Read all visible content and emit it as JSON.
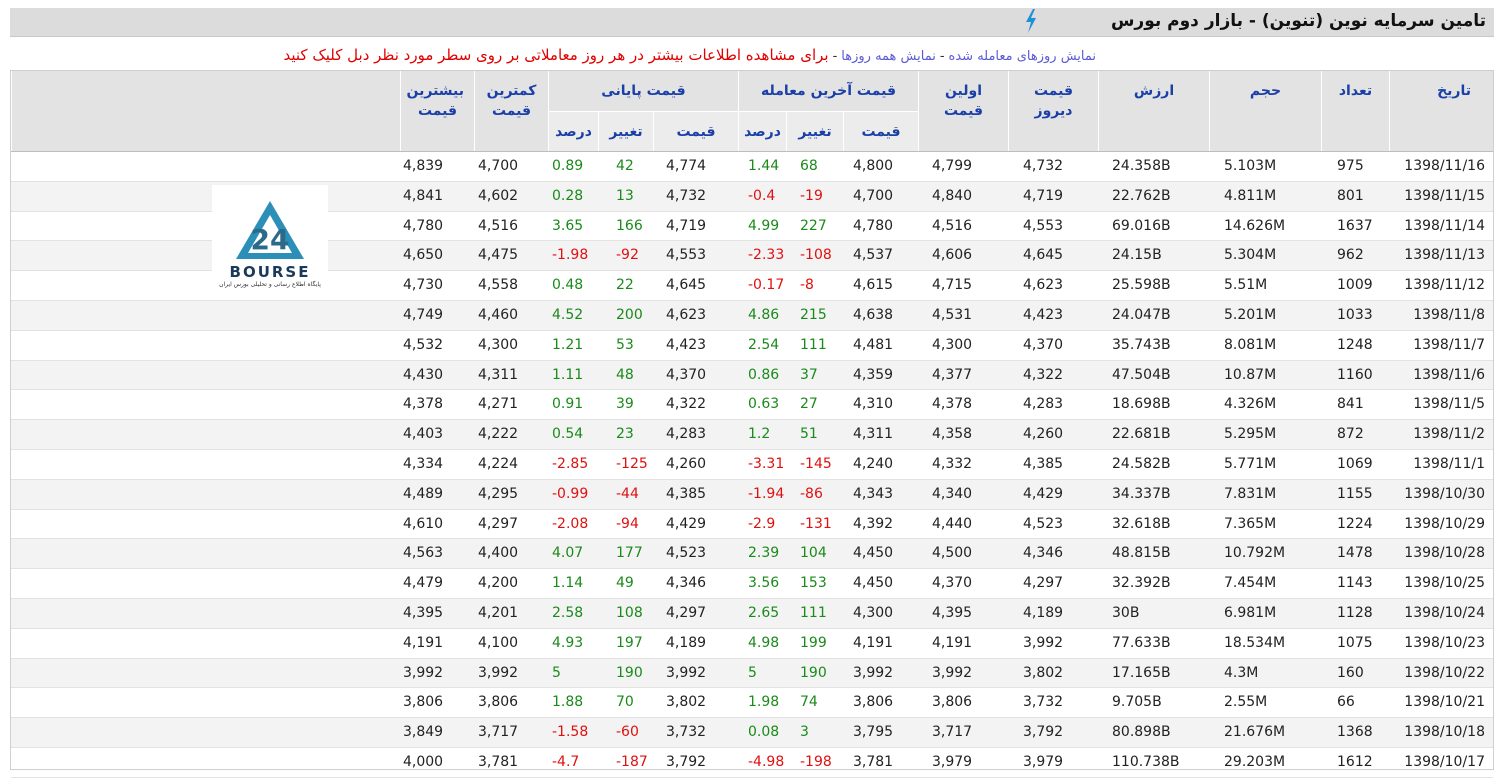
{
  "title": "تامین سرمایه نوین (تنوین) - بازار دوم بورس",
  "links": {
    "traded_days": "نمایش روزهای معامله شده",
    "all_days": "نمایش همه روزها",
    "separator": "-",
    "note": "برای مشاهده اطلاعات بیشتر در هر روز معاملاتی بر روی سطر مورد نظر دبل کلیک کنید"
  },
  "headers": {
    "date": "تاریخ",
    "count": "تعداد",
    "volume": "حجم",
    "value": "ارزش",
    "yesterday": "قیمت دیروز",
    "first": "اولین قیمت",
    "last_trade": "قیمت آخرین معامله",
    "closing": "قیمت پایانی",
    "low": "کمترین قیمت",
    "high": "بیشترین قیمت",
    "price": "قیمت",
    "change": "تغییر",
    "percent": "درصد"
  },
  "logo": {
    "text": "BOURSE",
    "subtitle": "پایگاه اطلاع رسانی و تحلیلی بورس ایران",
    "accent": "#2b8fb8"
  },
  "colors": {
    "positive": "#1a8a1a",
    "negative": "#e01010",
    "header_text": "#1a3fa8"
  },
  "rows": [
    [
      "4,839",
      "4,700",
      "0.89",
      "42",
      "4,774",
      "1.44",
      "68",
      "4,800",
      "4,799",
      "4,732",
      "24.358B",
      "5.103M",
      "975",
      "1398/11/16"
    ],
    [
      "4,841",
      "4,602",
      "0.28",
      "13",
      "4,732",
      "-0.4",
      "-19",
      "4,700",
      "4,840",
      "4,719",
      "22.762B",
      "4.811M",
      "801",
      "1398/11/15"
    ],
    [
      "4,780",
      "4,516",
      "3.65",
      "166",
      "4,719",
      "4.99",
      "227",
      "4,780",
      "4,516",
      "4,553",
      "69.016B",
      "14.626M",
      "1637",
      "1398/11/14"
    ],
    [
      "4,650",
      "4,475",
      "-1.98",
      "-92",
      "4,553",
      "-2.33",
      "-108",
      "4,537",
      "4,606",
      "4,645",
      "24.15B",
      "5.304M",
      "962",
      "1398/11/13"
    ],
    [
      "4,730",
      "4,558",
      "0.48",
      "22",
      "4,645",
      "-0.17",
      "-8",
      "4,615",
      "4,715",
      "4,623",
      "25.598B",
      "5.51M",
      "1009",
      "1398/11/12"
    ],
    [
      "4,749",
      "4,460",
      "4.52",
      "200",
      "4,623",
      "4.86",
      "215",
      "4,638",
      "4,531",
      "4,423",
      "24.047B",
      "5.201M",
      "1033",
      "1398/11/8"
    ],
    [
      "4,532",
      "4,300",
      "1.21",
      "53",
      "4,423",
      "2.54",
      "111",
      "4,481",
      "4,300",
      "4,370",
      "35.743B",
      "8.081M",
      "1248",
      "1398/11/7"
    ],
    [
      "4,430",
      "4,311",
      "1.11",
      "48",
      "4,370",
      "0.86",
      "37",
      "4,359",
      "4,377",
      "4,322",
      "47.504B",
      "10.87M",
      "1160",
      "1398/11/6"
    ],
    [
      "4,378",
      "4,271",
      "0.91",
      "39",
      "4,322",
      "0.63",
      "27",
      "4,310",
      "4,378",
      "4,283",
      "18.698B",
      "4.326M",
      "841",
      "1398/11/5"
    ],
    [
      "4,403",
      "4,222",
      "0.54",
      "23",
      "4,283",
      "1.2",
      "51",
      "4,311",
      "4,358",
      "4,260",
      "22.681B",
      "5.295M",
      "872",
      "1398/11/2"
    ],
    [
      "4,334",
      "4,224",
      "-2.85",
      "-125",
      "4,260",
      "-3.31",
      "-145",
      "4,240",
      "4,332",
      "4,385",
      "24.582B",
      "5.771M",
      "1069",
      "1398/11/1"
    ],
    [
      "4,489",
      "4,295",
      "-0.99",
      "-44",
      "4,385",
      "-1.94",
      "-86",
      "4,343",
      "4,340",
      "4,429",
      "34.337B",
      "7.831M",
      "1155",
      "1398/10/30"
    ],
    [
      "4,610",
      "4,297",
      "-2.08",
      "-94",
      "4,429",
      "-2.9",
      "-131",
      "4,392",
      "4,440",
      "4,523",
      "32.618B",
      "7.365M",
      "1224",
      "1398/10/29"
    ],
    [
      "4,563",
      "4,400",
      "4.07",
      "177",
      "4,523",
      "2.39",
      "104",
      "4,450",
      "4,500",
      "4,346",
      "48.815B",
      "10.792M",
      "1478",
      "1398/10/28"
    ],
    [
      "4,479",
      "4,200",
      "1.14",
      "49",
      "4,346",
      "3.56",
      "153",
      "4,450",
      "4,370",
      "4,297",
      "32.392B",
      "7.454M",
      "1143",
      "1398/10/25"
    ],
    [
      "4,395",
      "4,201",
      "2.58",
      "108",
      "4,297",
      "2.65",
      "111",
      "4,300",
      "4,395",
      "4,189",
      "30B",
      "6.981M",
      "1128",
      "1398/10/24"
    ],
    [
      "4,191",
      "4,100",
      "4.93",
      "197",
      "4,189",
      "4.98",
      "199",
      "4,191",
      "4,191",
      "3,992",
      "77.633B",
      "18.534M",
      "1075",
      "1398/10/23"
    ],
    [
      "3,992",
      "3,992",
      "5",
      "190",
      "3,992",
      "5",
      "190",
      "3,992",
      "3,992",
      "3,802",
      "17.165B",
      "4.3M",
      "160",
      "1398/10/22"
    ],
    [
      "3,806",
      "3,806",
      "1.88",
      "70",
      "3,802",
      "1.98",
      "74",
      "3,806",
      "3,806",
      "3,732",
      "9.705B",
      "2.55M",
      "66",
      "1398/10/21"
    ],
    [
      "3,849",
      "3,717",
      "-1.58",
      "-60",
      "3,732",
      "0.08",
      "3",
      "3,795",
      "3,717",
      "3,792",
      "80.898B",
      "21.676M",
      "1368",
      "1398/10/18"
    ],
    [
      "4,000",
      "3,781",
      "-4.7",
      "-187",
      "3,792",
      "-4.98",
      "-198",
      "3,781",
      "3,979",
      "3,979",
      "110.738B",
      "29.203M",
      "1612",
      "1398/10/17"
    ]
  ]
}
